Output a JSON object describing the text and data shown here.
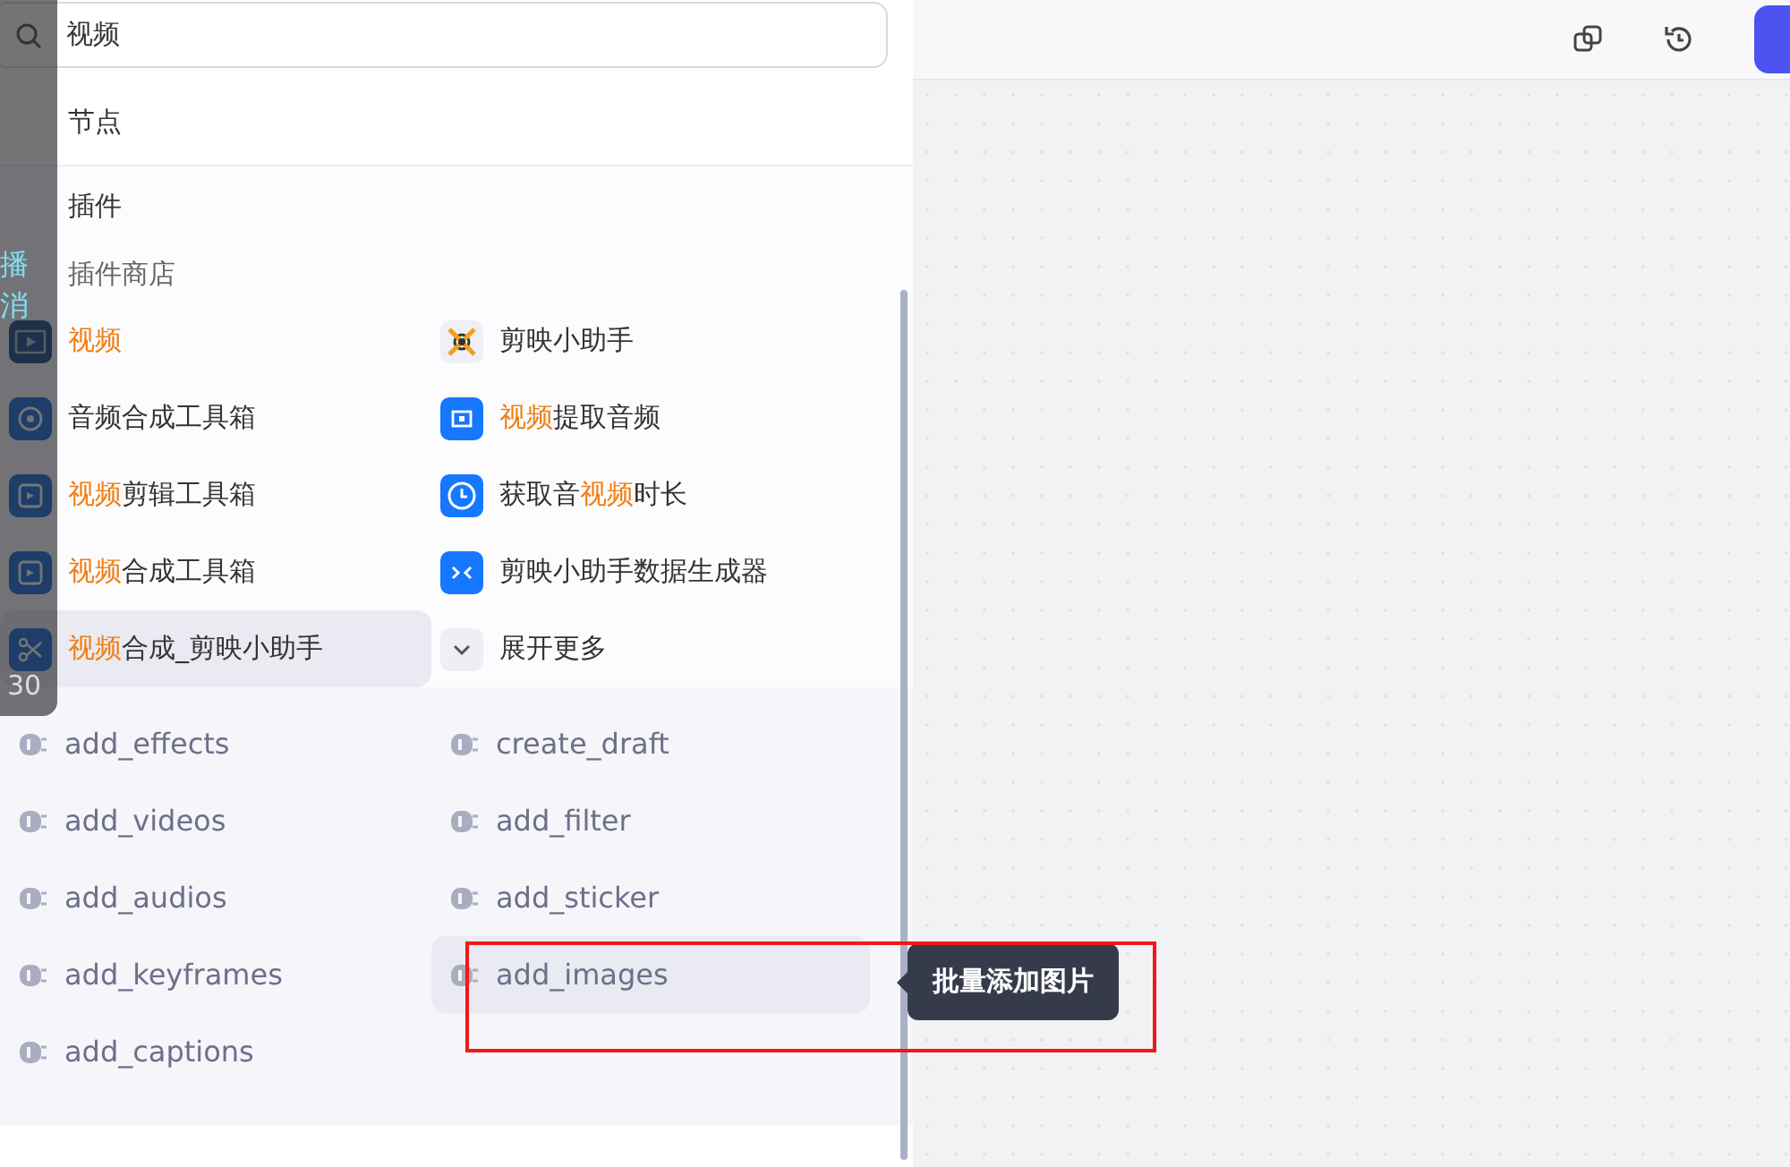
{
  "search": {
    "value": "视频"
  },
  "sections": [
    {
      "label": "节点"
    },
    {
      "label": "插件"
    }
  ],
  "store": {
    "label": "插件商店",
    "plugins": [
      {
        "kind": "video",
        "highlighted": false,
        "title": [
          {
            "text": "视频",
            "match": true
          }
        ]
      },
      {
        "kind": "logo",
        "highlighted": false,
        "title": [
          {
            "text": "剪映小助手",
            "match": false
          }
        ]
      },
      {
        "kind": "ring",
        "highlighted": false,
        "title": [
          {
            "text": "音频合成工具箱",
            "match": false
          }
        ]
      },
      {
        "kind": "film",
        "highlighted": false,
        "title": [
          {
            "text": "视频",
            "match": true
          },
          {
            "text": "提取音频",
            "match": false
          }
        ]
      },
      {
        "kind": "frame",
        "highlighted": false,
        "title": [
          {
            "text": "视频",
            "match": true
          },
          {
            "text": "剪辑工具箱",
            "match": false
          }
        ]
      },
      {
        "kind": "clock",
        "highlighted": false,
        "title": [
          {
            "text": "获取音",
            "match": false
          },
          {
            "text": "视频",
            "match": true
          },
          {
            "text": "时长",
            "match": false
          }
        ]
      },
      {
        "kind": "stack",
        "highlighted": false,
        "title": [
          {
            "text": "视频",
            "match": true
          },
          {
            "text": "合成工具箱",
            "match": false
          }
        ]
      },
      {
        "kind": "arrows",
        "highlighted": false,
        "title": [
          {
            "text": "剪映小助手数据生成器",
            "match": false
          }
        ]
      },
      {
        "kind": "scissors",
        "highlighted": true,
        "title": [
          {
            "text": "视频",
            "match": true
          },
          {
            "text": "合成_剪映小助手",
            "match": false
          }
        ]
      },
      {
        "kind": "chevron",
        "highlighted": false,
        "title": [
          {
            "text": "展开更多",
            "match": false
          }
        ]
      }
    ]
  },
  "tools": [
    {
      "name": "add_effects",
      "highlighted": false
    },
    {
      "name": "create_draft",
      "highlighted": false
    },
    {
      "name": "add_videos",
      "highlighted": false
    },
    {
      "name": "add_filter",
      "highlighted": false
    },
    {
      "name": "add_audios",
      "highlighted": false
    },
    {
      "name": "add_sticker",
      "highlighted": false
    },
    {
      "name": "add_keyframes",
      "highlighted": false
    },
    {
      "name": "add_images",
      "highlighted": true
    },
    {
      "name": "add_captions",
      "highlighted": false
    }
  ],
  "tooltip": {
    "text": "批量添加图片"
  },
  "overlay": {
    "lines": [
      "播",
      "消"
    ],
    "counter": "30"
  }
}
